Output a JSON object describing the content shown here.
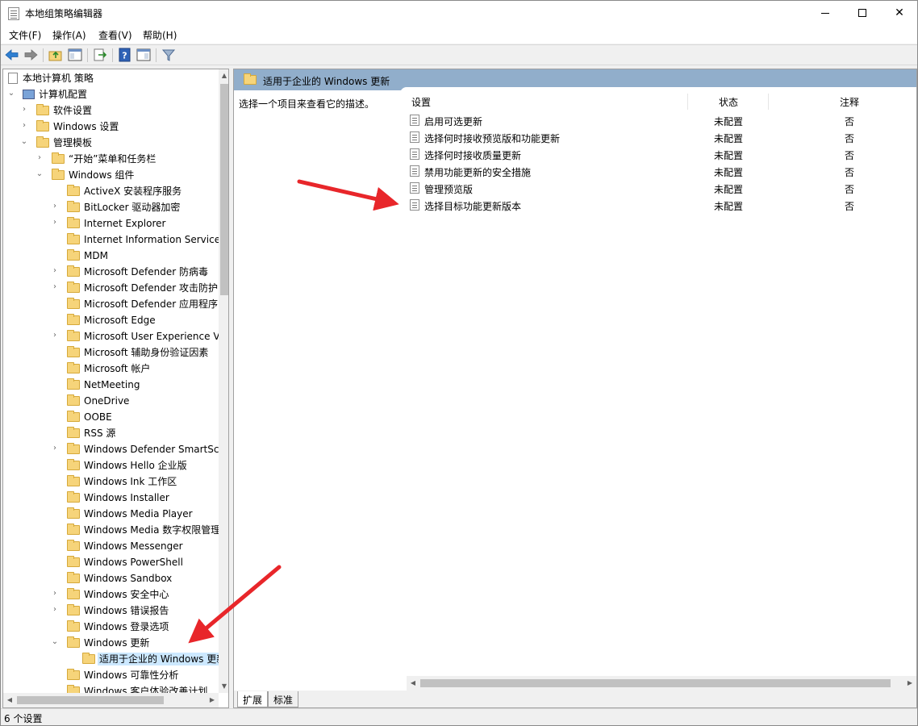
{
  "window": {
    "title": "本地组策略编辑器"
  },
  "menu": [
    {
      "label": "文件(F)"
    },
    {
      "label": "操作(A)"
    },
    {
      "label": "查看(V)"
    },
    {
      "label": "帮助(H)"
    }
  ],
  "toolbar": {
    "buttons": [
      "back-icon",
      "forward-icon",
      "up-folder-icon",
      "show-hide-tree-icon",
      "export-list-icon",
      "help-icon",
      "properties-view-icon",
      "filter-icon"
    ]
  },
  "tree": {
    "root": "本地计算机 策略",
    "computer_config": "计算机配置",
    "items": [
      {
        "label": "软件设置"
      },
      {
        "label": "Windows 设置"
      },
      {
        "label": "管理模板"
      },
      {
        "label": "“开始”菜单和任务栏"
      },
      {
        "label": "Windows 组件"
      },
      {
        "label": "ActiveX 安装程序服务"
      },
      {
        "label": "BitLocker 驱动器加密"
      },
      {
        "label": "Internet Explorer"
      },
      {
        "label": "Internet Information Service"
      },
      {
        "label": "MDM"
      },
      {
        "label": "Microsoft Defender 防病毒"
      },
      {
        "label": "Microsoft Defender 攻击防护"
      },
      {
        "label": "Microsoft Defender 应用程序"
      },
      {
        "label": "Microsoft Edge"
      },
      {
        "label": "Microsoft User Experience V"
      },
      {
        "label": "Microsoft 辅助身份验证因素"
      },
      {
        "label": "Microsoft 帐户"
      },
      {
        "label": "NetMeeting"
      },
      {
        "label": "OneDrive"
      },
      {
        "label": "OOBE"
      },
      {
        "label": "RSS 源"
      },
      {
        "label": "Windows Defender SmartSc"
      },
      {
        "label": "Windows Hello 企业版"
      },
      {
        "label": "Windows Ink 工作区"
      },
      {
        "label": "Windows Installer"
      },
      {
        "label": "Windows Media Player"
      },
      {
        "label": "Windows Media 数字权限管理"
      },
      {
        "label": "Windows Messenger"
      },
      {
        "label": "Windows PowerShell"
      },
      {
        "label": "Windows Sandbox"
      },
      {
        "label": "Windows 安全中心"
      },
      {
        "label": "Windows 错误报告"
      },
      {
        "label": "Windows 登录选项"
      },
      {
        "label": "Windows 更新"
      },
      {
        "label": "适用于企业的 Windows 更新"
      },
      {
        "label": "Windows 可靠性分析"
      },
      {
        "label": "Windows 客户体验改善计划"
      }
    ]
  },
  "right": {
    "header": "适用于企业的 Windows 更新",
    "description": "选择一个项目来查看它的描述。",
    "columns": {
      "setting": "设置",
      "state": "状态",
      "comment": "注释"
    },
    "rows": [
      {
        "name": "启用可选更新",
        "state": "未配置",
        "comment": "否"
      },
      {
        "name": "选择何时接收预览版和功能更新",
        "state": "未配置",
        "comment": "否"
      },
      {
        "name": "选择何时接收质量更新",
        "state": "未配置",
        "comment": "否"
      },
      {
        "name": "禁用功能更新的安全措施",
        "state": "未配置",
        "comment": "否"
      },
      {
        "name": "管理预览版",
        "state": "未配置",
        "comment": "否"
      },
      {
        "name": "选择目标功能更新版本",
        "state": "未配置",
        "comment": "否"
      }
    ],
    "tabs": [
      {
        "label": "扩展"
      },
      {
        "label": "标准"
      }
    ]
  },
  "status": {
    "text": "6 个设置"
  },
  "colors": {
    "header_bg": "#91aecb",
    "selected_bg": "#cce8ff",
    "arrow": "#e8262a"
  }
}
